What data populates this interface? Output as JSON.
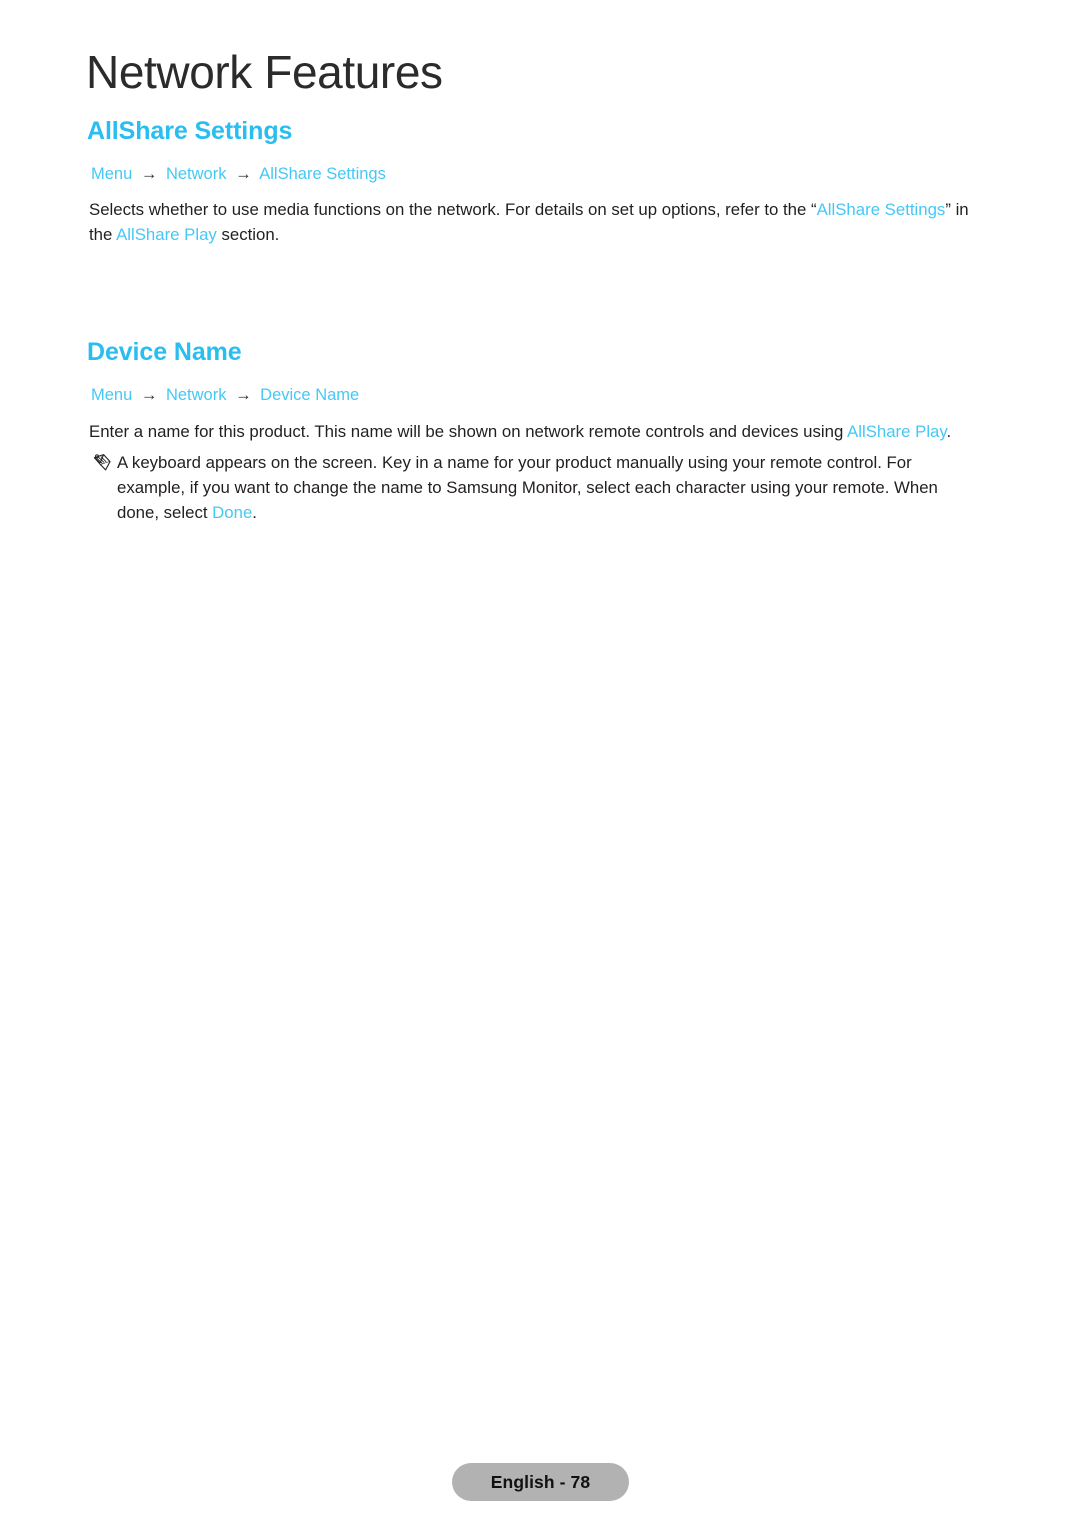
{
  "chapter": {
    "title": "Network Features"
  },
  "sections": [
    {
      "heading": "AllShare Settings",
      "breadcrumb": {
        "root": "Menu",
        "arrow": "→",
        "middle": "Network",
        "leaf": "AllShare Settings"
      },
      "paragraph": {
        "part1": "Selects whether to use media functions on the network. For details on set up options, refer to the “",
        "link1": "AllShare Settings",
        "part2": "” in the ",
        "link2": "AllShare Play",
        "part3": " section."
      }
    },
    {
      "heading": "Device Name",
      "breadcrumb": {
        "root": "Menu",
        "arrow": "→",
        "middle": "Network",
        "leaf": "Device Name"
      },
      "paragraph": {
        "part1": "Enter a name for this product. This name will be shown on network remote controls and devices using ",
        "link1": "AllShare Play",
        "part2": "."
      },
      "note": {
        "icon": "pencil-note-icon",
        "part1": "A keyboard appears on the screen. Key in a name for your product manually using your remote control. For example, if you want to change the name to Samsung Monitor, select each character using your remote. When done, select ",
        "link1": "Done",
        "part2": "."
      }
    }
  ],
  "footer": {
    "page_label": "English - 78"
  },
  "colors": {
    "accent": "#29bdf0",
    "link": "#45c8f5",
    "text": "#231f20",
    "footer_pill": "#b2b2b2"
  }
}
